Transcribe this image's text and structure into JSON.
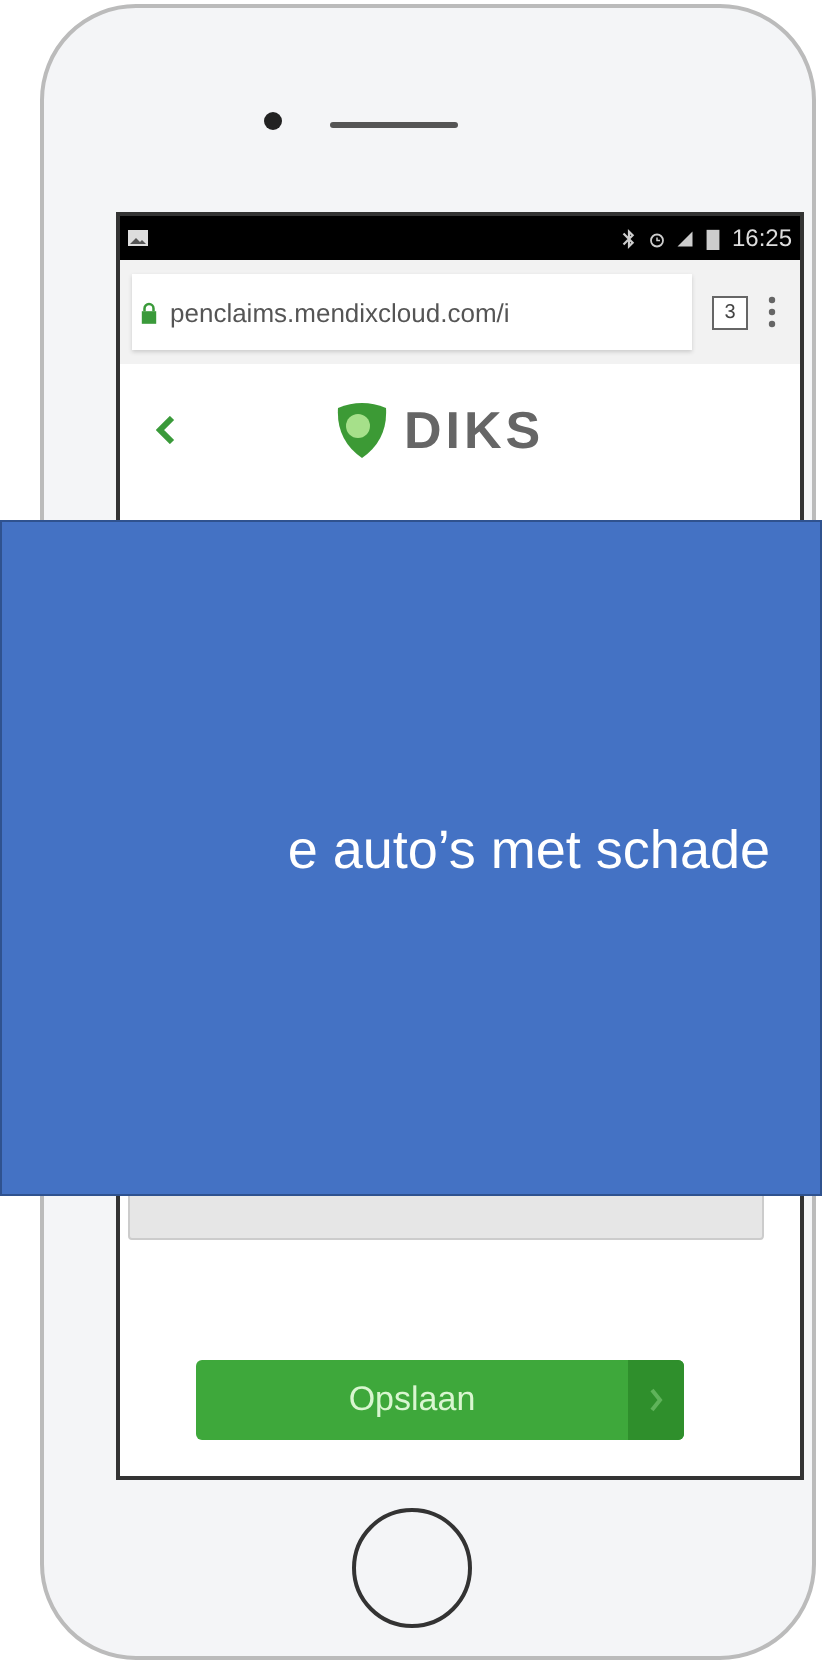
{
  "phone": {
    "status_bar": {
      "time": "16:25"
    },
    "browser_bar": {
      "url": "penclaims.mendixcloud.com/i",
      "tab_count": "3"
    },
    "app_header": {
      "logo_text": "DIKS"
    },
    "save_button": {
      "label": "Opslaan"
    }
  },
  "overlay": {
    "text": "e auto’s met schade"
  }
}
